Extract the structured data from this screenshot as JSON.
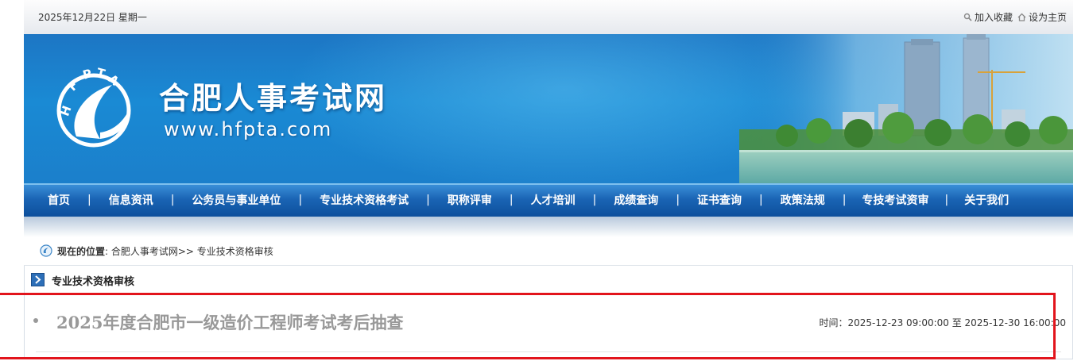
{
  "topbar": {
    "date": "2025年12月22日 星期一",
    "bookmark_label": "加入收藏",
    "homepage_label": "设为主页"
  },
  "banner": {
    "site_name": "合肥人事考试网",
    "site_url": "www.hfpta.com",
    "logo_text": "HFPTA"
  },
  "nav": {
    "items": [
      "首页",
      "信息资讯",
      "公务员与事业单位",
      "专业技术资格考试",
      "职称评审",
      "人才培训",
      "成绩查询",
      "证书查询",
      "政策法规",
      "专技考试资审",
      "关于我们"
    ],
    "separator": "|"
  },
  "breadcrumb": {
    "prefix": "现在的位置",
    "path": ": 合肥人事考试网>> 专业技术资格审核"
  },
  "section": {
    "title": "专业技术资格审核",
    "item": {
      "title": "2025年度合肥市一级造价工程师考试考后抽查",
      "time": "时间：2025-12-23 09:00:00 至 2025-12-30 16:00:00"
    }
  },
  "colors": {
    "banner_blue": "#1a8ad4",
    "nav_blue": "#1a64b4",
    "highlight_red": "#e2141c"
  }
}
